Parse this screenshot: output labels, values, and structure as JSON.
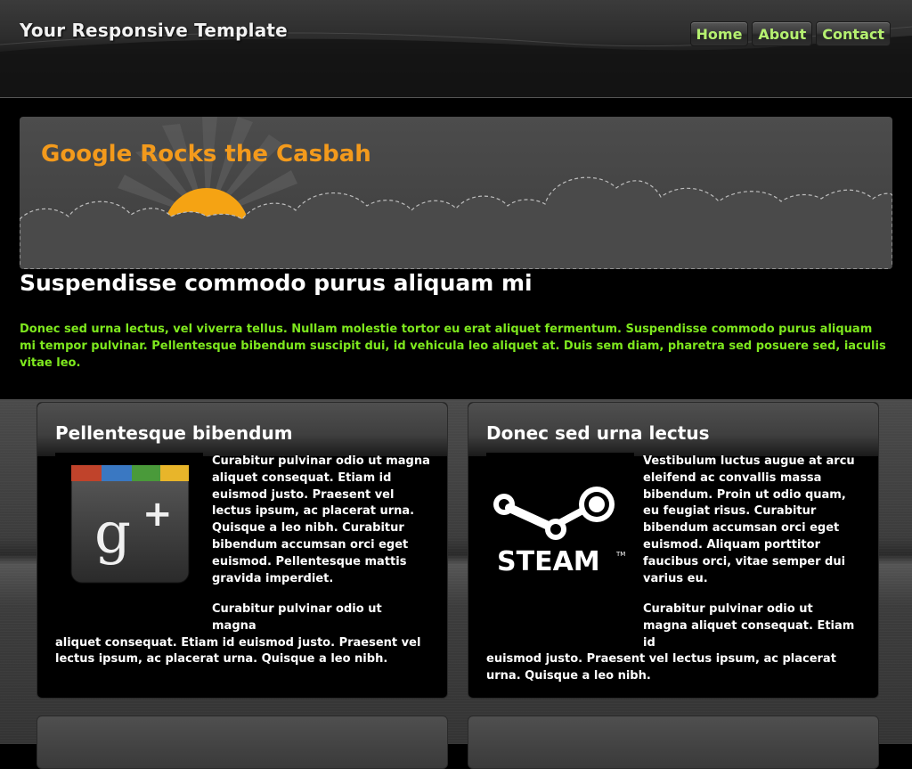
{
  "header": {
    "site_title": "Your Responsive Template",
    "nav": [
      {
        "label": "Home"
      },
      {
        "label": "About"
      },
      {
        "label": "Contact"
      }
    ]
  },
  "hero": {
    "title": "Google Rocks the Casbah"
  },
  "main": {
    "heading": "Suspendisse commodo purus aliquam mi",
    "intro": "Donec sed urna lectus, vel viverra tellus. Nullam molestie tortor eu erat aliquet fermentum. Suspendisse commodo purus aliquam mi tempor pulvinar. Pellentesque bibendum suscipit dui, id vehicula leo aliquet at. Duis sem diam, pharetra sed posuere sed, iaculis vitae leo."
  },
  "cards": [
    {
      "title": "Pellentesque bibendum",
      "image_icon": "google-plus-icon",
      "text1": "Curabitur pulvinar odio ut magna aliquet consequat. Etiam id euismod justo. Praesent vel lectus ipsum, ac placerat urna. Quisque a leo nibh. Curabitur bibendum accumsan orci eget euismod. Pellentesque mattis gravida imperdiet.",
      "text2_first": "Curabitur pulvinar odio ut magna",
      "text2_rest": "aliquet consequat. Etiam id euismod justo. Praesent vel lectus ipsum, ac placerat urna. Quisque a leo nibh."
    },
    {
      "title": "Donec sed urna lectus",
      "image_icon": "steam-logo-icon",
      "image_text": "STEAM",
      "text1": "Vestibulum luctus augue at arcu eleifend ac convallis massa bibendum. Proin ut odio quam, eu feugiat risus. Curabitur bibendum accumsan orci eget euismod. Aliquam porttitor faucibus orci, vitae semper dui varius eu.",
      "text2_first": "Curabitur pulvinar odio ut magna aliquet consequat. Etiam id",
      "text2_rest": "euismod justo. Praesent vel lectus ipsum, ac placerat urna. Quisque a leo nibh."
    }
  ],
  "colors": {
    "accent_green": "#7ee81e",
    "nav_green": "#b5f070",
    "hero_orange": "#f39a1c"
  }
}
